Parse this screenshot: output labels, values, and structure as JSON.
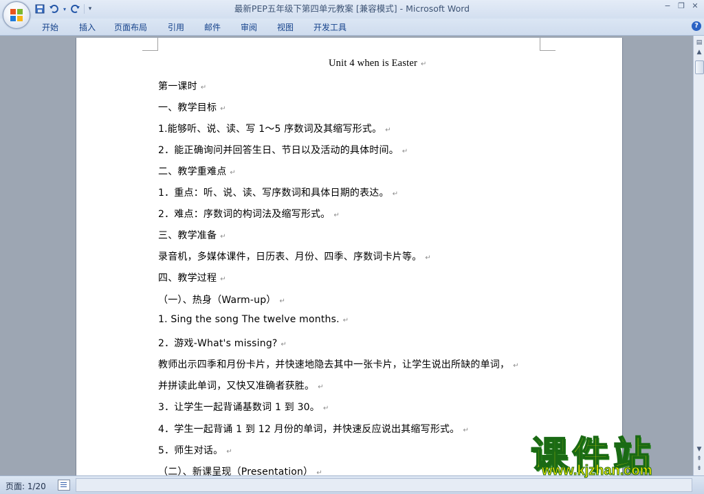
{
  "window": {
    "title_doc": "最新PEP五年级下第四单元教案 [兼容模式] - ",
    "title_app": "Microsoft Word",
    "minimize": "−",
    "restore": "❐",
    "close": "✕"
  },
  "quick_access": {
    "save": "save-icon",
    "undo": "undo-icon",
    "redo": "redo-icon",
    "customize": "customize-icon"
  },
  "ribbon": {
    "tabs": [
      {
        "label": "开始"
      },
      {
        "label": "插入"
      },
      {
        "label": "页面布局"
      },
      {
        "label": "引用"
      },
      {
        "label": "邮件"
      },
      {
        "label": "审阅"
      },
      {
        "label": "视图"
      },
      {
        "label": "开发工具"
      }
    ],
    "help": "?"
  },
  "document": {
    "lines": [
      "Unit 4    when is Easter",
      "第一课时",
      "一、教学目标",
      "1.能够听、说、读、写 1～5 序数词及其缩写形式。",
      "2．能正确询问并回答生日、节日以及活动的具体时间。",
      "二、教学重难点",
      "1．重点：听、说、读、写序数词和具体日期的表达。",
      "2．难点：序数词的构词法及缩写形式。",
      "三、教学准备",
      "录音机，多媒体课件，日历表、月份、四季、序数词卡片等。",
      "四、教学过程",
      "（一）、热身（Warm-up）",
      "1. Sing the song The twelve months.",
      "2．游戏-What's missing?",
      "教师出示四季和月份卡片，并快速地隐去其中一张卡片，让学生说出所缺的单词，",
      "并拼读此单词，又快又准确者获胜。",
      "3．让学生一起背诵基数词 1 到 30。",
      "4．学生一起背诵 1 到 12 月份的单词，并快速反应说出其缩写形式。",
      "5．师生对话。",
      "（二）、新课呈现（Presentation）"
    ],
    "paragraph_mark": "↵"
  },
  "status": {
    "page_info": "页面: 1/20"
  },
  "watermark": {
    "brand": "课件站",
    "url": "www.kjzhan.com"
  },
  "colors": {
    "ribbon_text": "#15428b",
    "workspace": "#9da6b3",
    "watermark_fill": "#f2e600",
    "watermark_stroke": "#1a6a14"
  }
}
